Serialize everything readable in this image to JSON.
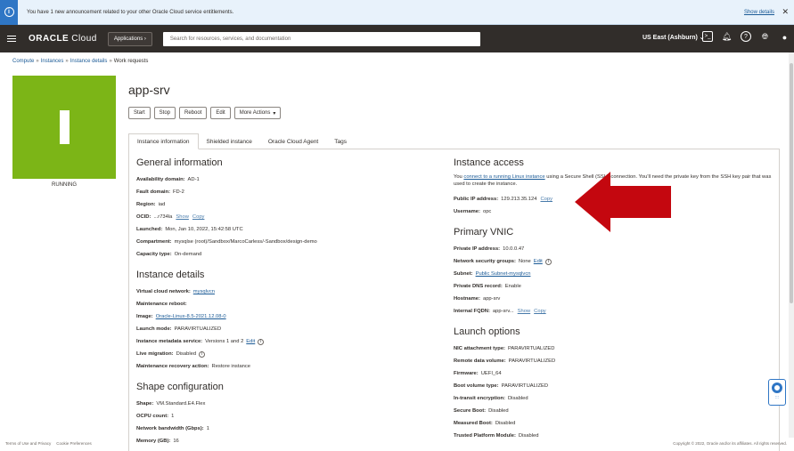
{
  "announcement": {
    "message": "You have 1 new announcement related to your other Oracle Cloud service entitlements.",
    "show_details": "Show details"
  },
  "nav": {
    "brand": "ORACLE",
    "brand_sub": "Cloud",
    "applications": "Applications",
    "search_placeholder": "Search for resources, services, and documentation",
    "region": "US East (Ashburn)"
  },
  "breadcrumb": {
    "compute": "Compute",
    "instances": "Instances",
    "instance_details": "Instance details",
    "current": "Work requests"
  },
  "status": "RUNNING",
  "instance_name": "app-srv",
  "actions": [
    "Start",
    "Stop",
    "Reboot",
    "Edit",
    "More Actions"
  ],
  "tabs": [
    "Instance information",
    "Shielded instance",
    "Oracle Cloud Agent",
    "Tags"
  ],
  "general": {
    "title": "General information",
    "availability_domain_label": "Availability domain:",
    "availability_domain": "AD-1",
    "fault_domain_label": "Fault domain:",
    "fault_domain": "FD-2",
    "region_label": "Region:",
    "region": "iad",
    "ocid_label": "OCID:",
    "ocid": "...r734la",
    "show": "Show",
    "copy": "Copy",
    "launched_label": "Launched:",
    "launched": "Mon, Jan 10, 2022, 15:42:58 UTC",
    "compartment_label": "Compartment:",
    "compartment": "mysqlse (root)/Sandbox/MarcoCarless/-Sandbox/design-demo",
    "capacity_label": "Capacity type:",
    "capacity": "On-demand"
  },
  "instance_details": {
    "title": "Instance details",
    "vcn_label": "Virtual cloud network:",
    "vcn": "mysqlvcn",
    "maint_reboot_label": "Maintenance reboot:",
    "image_label": "Image:",
    "image": "Oracle-Linux-8.5-2021.12.08-0",
    "launch_mode_label": "Launch mode:",
    "launch_mode": "PARAVIRTUALIZED",
    "imds_label": "Instance metadata service:",
    "imds": "Versions 1 and 2",
    "edit": "Edit",
    "live_migration_label": "Live migration:",
    "live_migration": "Disabled",
    "recovery_label": "Maintenance recovery action:",
    "recovery": "Restore instance"
  },
  "shape": {
    "title": "Shape configuration",
    "shape_label": "Shape:",
    "shape": "VM.Standard.E4.Flex",
    "ocpu_label": "OCPU count:",
    "ocpu": "1",
    "bandwidth_label": "Network bandwidth (Gbps):",
    "bandwidth": "1",
    "memory_label": "Memory (GB):",
    "memory": "16"
  },
  "access": {
    "title": "Instance access",
    "para_pre": "You",
    "para_link": "connect to a running Linux instance",
    "para_post": "using a Secure Shell (SSH) connection. You'll need the private key from the SSH key pair that was used to create the instance.",
    "public_ip_label": "Public IP address:",
    "public_ip": "129.213.35.124",
    "copy": "Copy",
    "username_label": "Username:",
    "username": "opc"
  },
  "vnic": {
    "title": "Primary VNIC",
    "private_ip_label": "Private IP address:",
    "private_ip": "10.0.0.47",
    "nsg_label": "Network security groups:",
    "nsg": "None",
    "edit": "Edit",
    "subnet_label": "Subnet:",
    "subnet": "Public Subnet-mysqlvcn",
    "dns_label": "Private DNS record:",
    "dns": "Enable",
    "hostname_label": "Hostname:",
    "hostname": "app-srv",
    "fqdn_label": "Internal FQDN:",
    "fqdn": "app-srv...",
    "show": "Show",
    "copy": "Copy"
  },
  "launch_options": {
    "title": "Launch options",
    "nic_label": "NIC attachment type:",
    "nic": "PARAVIRTUALIZED",
    "remote_label": "Remote data volume:",
    "remote": "PARAVIRTUALIZED",
    "firmware_label": "Firmware:",
    "firmware": "UEFI_64",
    "boot_label": "Boot volume type:",
    "boot": "PARAVIRTUALIZED",
    "transit_label": "In-transit encryption:",
    "transit": "Disabled",
    "secure_boot_label": "Secure Boot:",
    "secure_boot": "Disabled",
    "measured_label": "Measured Boot:",
    "measured": "Disabled",
    "tpm_label": "Trusted Platform Module:",
    "tpm": "Disabled"
  },
  "footer": {
    "terms": "Terms of Use and Privacy",
    "cookies": "Cookie Preferences",
    "copyright": "Copyright © 2022, Oracle and/or its affiliates. All rights reserved."
  },
  "colors": {
    "status_green": "#7cb517",
    "nav_bg": "#312d2a",
    "arrow_red": "#c4070f",
    "link": "#1a5a96"
  }
}
